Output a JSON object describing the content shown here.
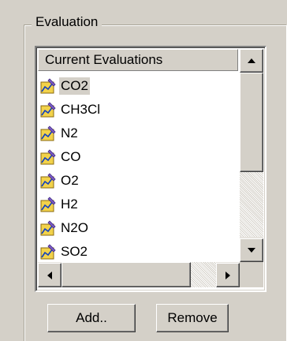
{
  "group": {
    "title": "Evaluation"
  },
  "list": {
    "header": "Current Evaluations",
    "items": [
      {
        "label": "CO2",
        "icon": "evaluation-chart-icon",
        "selected": true
      },
      {
        "label": "CH3Cl",
        "icon": "evaluation-chart-icon"
      },
      {
        "label": "N2",
        "icon": "evaluation-chart-icon"
      },
      {
        "label": "CO",
        "icon": "evaluation-chart-icon"
      },
      {
        "label": "O2",
        "icon": "evaluation-chart-icon"
      },
      {
        "label": "H2",
        "icon": "evaluation-chart-icon"
      },
      {
        "label": "N2O",
        "icon": "evaluation-chart-icon"
      },
      {
        "label": "SO2",
        "icon": "evaluation-chart-icon"
      }
    ]
  },
  "buttons": {
    "add": "Add..",
    "remove": "Remove"
  },
  "colors": {
    "face": "#d4d0c8",
    "window": "#ffffff",
    "shadow": "#808080",
    "highlight": "#ffffff"
  }
}
